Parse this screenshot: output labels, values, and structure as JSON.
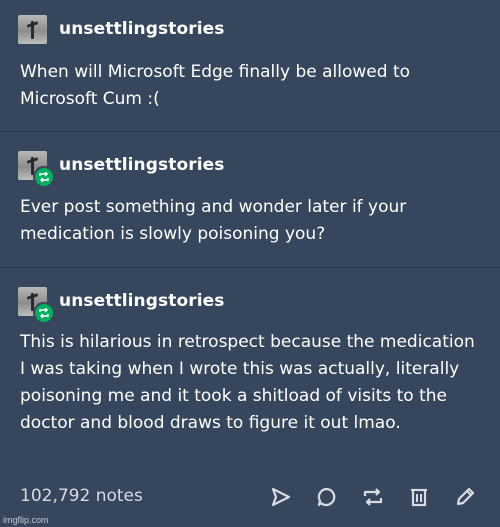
{
  "posts": [
    {
      "username": "unsettlingstories",
      "text": "When will Microsoft Edge finally be allowed to Microsoft Cum :(",
      "reblog": false
    },
    {
      "username": "unsettlingstories",
      "text": "Ever post something and wonder later if your medication is slowly poisoning you?",
      "reblog": true
    },
    {
      "username": "unsettlingstories",
      "text": "This is hilarious in retrospect because the medication I was taking when I wrote this was actually, literally poisoning me and it took a shitload of visits to the doctor and blood draws to figure it out lmao.",
      "reblog": true
    }
  ],
  "footer": {
    "notes": "102,792 notes",
    "actions": [
      "share-icon",
      "reply-icon",
      "reblog-icon",
      "delete-icon",
      "edit-icon"
    ]
  },
  "watermark": "imgflip.com",
  "colors": {
    "background": "#36465d",
    "reblog_badge": "#00b05e",
    "text": "#ffffff"
  }
}
